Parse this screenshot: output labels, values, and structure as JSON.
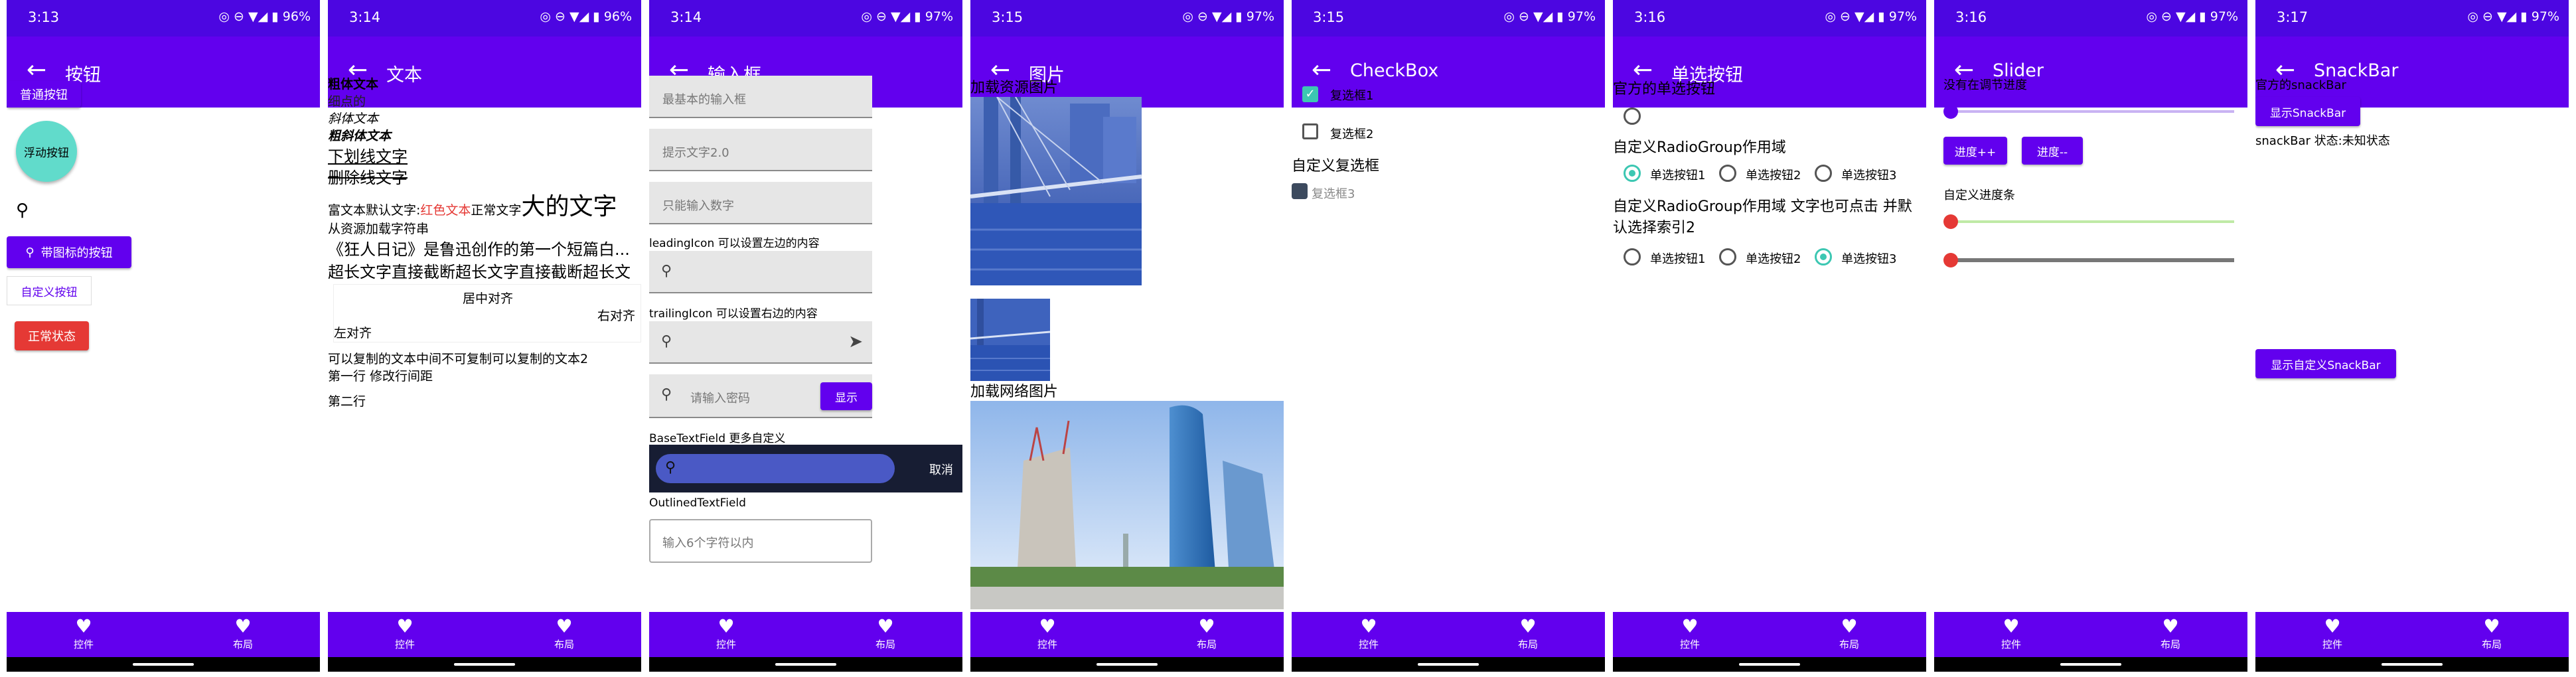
{
  "colors": {
    "primary": "#6200ee",
    "status": "#4c06e1",
    "teal": "#3cc7b2",
    "red": "#e53935"
  },
  "nav": {
    "left": "控件",
    "right": "布局"
  },
  "status_icons": "◎ ⊖ ▼◢ ▮",
  "screens": [
    {
      "time": "3:13",
      "battery": "96%",
      "title": "按钮"
    },
    {
      "time": "3:14",
      "battery": "96%",
      "title": "文本"
    },
    {
      "time": "3:14",
      "battery": "97%",
      "title": "输入框"
    },
    {
      "time": "3:15",
      "battery": "97%",
      "title": "图片"
    },
    {
      "time": "3:15",
      "battery": "97%",
      "title": "CheckBox"
    },
    {
      "time": "3:16",
      "battery": "97%",
      "title": "单选按钮"
    },
    {
      "time": "3:16",
      "battery": "97%",
      "title": "Slider"
    },
    {
      "time": "3:17",
      "battery": "97%",
      "title": "SnackBar"
    }
  ],
  "buttons": {
    "normal": "普通按钮",
    "fab": "浮动按钮",
    "icon_btn": "带图标的按钮",
    "custom": "自定义按钮",
    "normal_state": "正常状态"
  },
  "text": {
    "bold": "粗体文本",
    "thin": "细点的",
    "italic": "斜体文本",
    "bold_italic": "粗斜体文本",
    "underline": "下划线文字",
    "strike": "删除线文字",
    "rich_default": "富文本默认文字:",
    "rich_red": "红色文本",
    "rich_normal": "正常文字",
    "rich_big": "大的文字",
    "resource": "从资源加载字符串",
    "ellipsis": "《狂人日记》是鲁迅创作的第一个短篇白...",
    "clip": "超长文字直接截断超长文字直接截断超长文",
    "center": "居中对齐",
    "right": "右对齐",
    "left": "左对齐",
    "copy": "可以复制的文本中间不可复制可以复制的文本2",
    "line1": "第一行 修改行间距",
    "line2": "第二行"
  },
  "inputs": {
    "basic": "最基本的输入框",
    "hint": "提示文字2.0",
    "number": "只能输入数字",
    "leading_label": "leadingIcon 可以设置左边的内容",
    "trailing_label": "trailingIcon 可以设置右边的内容",
    "password": "请输入密码",
    "show": "显示",
    "base_label": "BaseTextField 更多自定义",
    "cancel": "取消",
    "outlined_label": "OutlinedTextField",
    "outlined_ph": "输入6个字符以内"
  },
  "images": {
    "res": "加载资源图片",
    "net": "加载网络图片"
  },
  "checkbox": {
    "cb1": "复选框1",
    "cb2": "复选框2",
    "custom": "自定义复选框",
    "cb3": "复选框3"
  },
  "radio": {
    "official": "官方的单选按钮",
    "group1": "自定义RadioGroup作用域",
    "r1": "单选按钮1",
    "r2": "单选按钮2",
    "r3": "单选按钮3",
    "group2": "自定义RadioGroup作用域 文字也可点击 并默认选择索引2"
  },
  "slider": {
    "no_step": "没有在调节进度",
    "plus": "进度++",
    "minus": "进度--",
    "custom": "自定义进度条",
    "value": 0.0
  },
  "snackbar": {
    "official": "官方的snackBar",
    "show": "显示SnackBar",
    "state": "snackBar 状态:未知状态",
    "show_custom": "显示自定义SnackBar"
  }
}
